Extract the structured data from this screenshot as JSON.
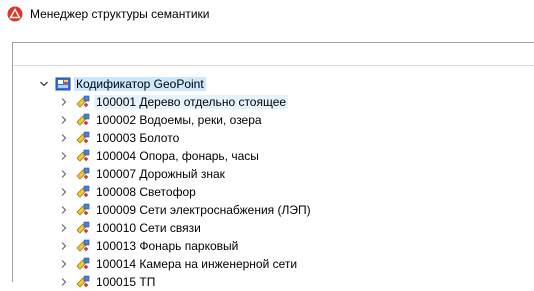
{
  "window": {
    "title": "Менеджер структуры семантики",
    "app_icon": "app-red-triangle-icon"
  },
  "tree": {
    "root": {
      "label": "Кодификатор GeoPoint",
      "icon": "classifier-root-icon",
      "expanded": true,
      "selected": true
    },
    "items": [
      {
        "label": "100001 Дерево отдельно стоящее",
        "icon": "semantic-class-icon"
      },
      {
        "label": "100002 Водоемы, реки, озера",
        "icon": "semantic-class-icon"
      },
      {
        "label": "100003 Болото",
        "icon": "semantic-class-icon"
      },
      {
        "label": "100004 Опора, фонарь, часы",
        "icon": "semantic-class-icon"
      },
      {
        "label": "100007 Дорожный знак",
        "icon": "semantic-class-icon"
      },
      {
        "label": "100008 Светофор",
        "icon": "semantic-class-icon"
      },
      {
        "label": "100009 Сети электроснабжения (ЛЭП)",
        "icon": "semantic-class-icon"
      },
      {
        "label": "100010 Сети связи",
        "icon": "semantic-class-icon"
      },
      {
        "label": "100013 Фонарь парковый",
        "icon": "semantic-class-icon"
      },
      {
        "label": "100014 Камера на инженерной сети",
        "icon": "semantic-class-icon"
      },
      {
        "label": "100015 ТП",
        "icon": "semantic-class-icon"
      }
    ]
  },
  "colors": {
    "selection": "#cce8ff",
    "hover": "#e5f3ff",
    "app_icon_red": "#d9352b"
  }
}
